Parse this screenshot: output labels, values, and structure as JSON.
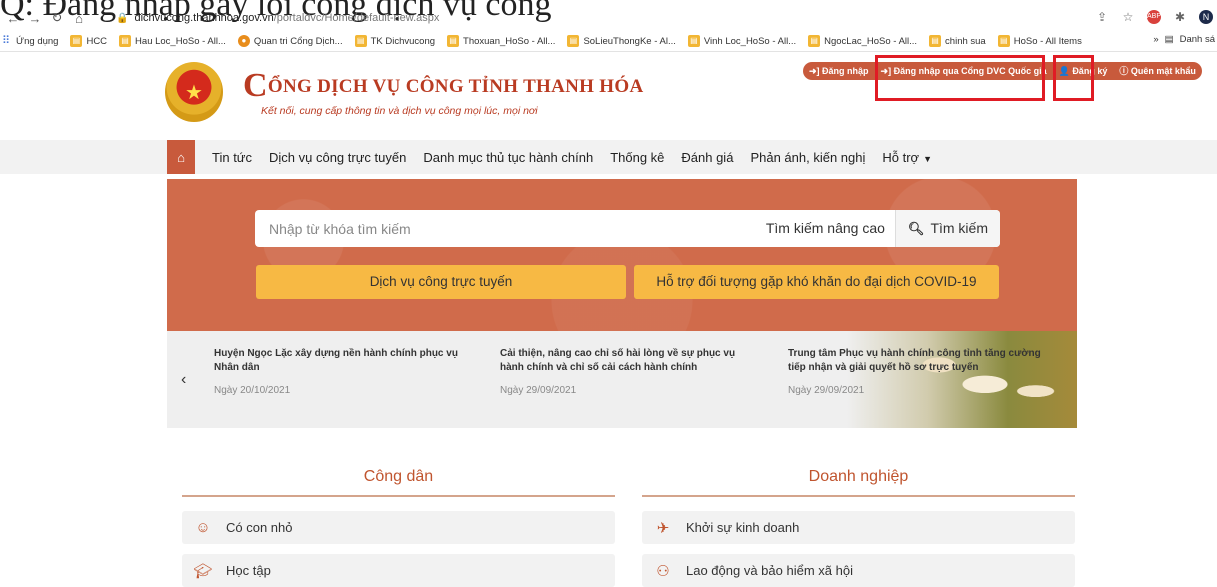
{
  "stray_text": "Q: Đăng nhập gây lỗi cổng dịch vụ công",
  "browser": {
    "url_domain": "dichvucong.thanhhoa.gov.vn",
    "url_path": "/portaldvc/Home/default-new.aspx",
    "profile_initial": "N"
  },
  "bookmarks": [
    "Ứng dụng",
    "HCC",
    "Hau Loc_HoSo - All...",
    "Quan tri Cổng Dịch...",
    "TK Dichvucong",
    "Thoxuan_HoSo - All...",
    "SoLieuThongKe - Al...",
    "Vinh Loc_HoSo - All...",
    "NgocLac_HoSo - All...",
    "chinh sua",
    "HoSo - All Items"
  ],
  "bookmarks_more": "»",
  "bookmarks_list": "Danh sá",
  "top_buttons": {
    "login": "➜] Đăng nhập",
    "login_national": "➜] Đăng nhập qua Cổng DVC Quốc gia",
    "register": "Đăng ký",
    "forgot": "Quên mật khẩu"
  },
  "header": {
    "title_first_letter": "C",
    "title_rest": "ỔNG DỊCH VỤ CÔNG TỈNH THANH HÓA",
    "subtitle": "Kết nối, cung cấp thông tin và dịch vụ công mọi lúc, mọi nơi"
  },
  "nav": {
    "items": [
      "Tin tức",
      "Dịch vụ công trực tuyến",
      "Danh mục thủ tục hành chính",
      "Thống kê",
      "Đánh giá",
      "Phản ánh, kiến nghị",
      "Hỗ trợ"
    ]
  },
  "search": {
    "placeholder": "Nhập từ khóa tìm kiếm",
    "advanced": "Tìm kiếm nâng cao",
    "button": "Tìm kiếm"
  },
  "cta": {
    "online_services": "Dịch vụ công trực tuyến",
    "covid_support": "Hỗ trợ đối tượng gặp khó khăn do đại dịch COVID-19"
  },
  "news": [
    {
      "title": "Huyện Ngọc Lặc xây dựng nền hành chính phục vụ Nhân dân",
      "date": "Ngày 20/10/2021"
    },
    {
      "title": "Cải thiện, nâng cao chỉ số hài lòng về sự phục vụ hành chính và chỉ số cải cách hành chính",
      "date": "Ngày 29/09/2021"
    },
    {
      "title": "Trung tâm Phục vụ hành chính công tỉnh tăng cường tiếp nhận và giải quyết hồ sơ trực tuyến",
      "date": "Ngày 29/09/2021"
    }
  ],
  "sections": {
    "citizen": {
      "title": "Công dân",
      "items": [
        "Có con nhỏ",
        "Học tập"
      ]
    },
    "business": {
      "title": "Doanh nghiệp",
      "items": [
        "Khởi sự kinh doanh",
        "Lao động và bảo hiểm xã hội"
      ]
    }
  },
  "colors": {
    "brand": "#c85a3c",
    "hero": "#d06b4b",
    "cta": "#f7b944",
    "highlight_box": "#e01b24"
  }
}
